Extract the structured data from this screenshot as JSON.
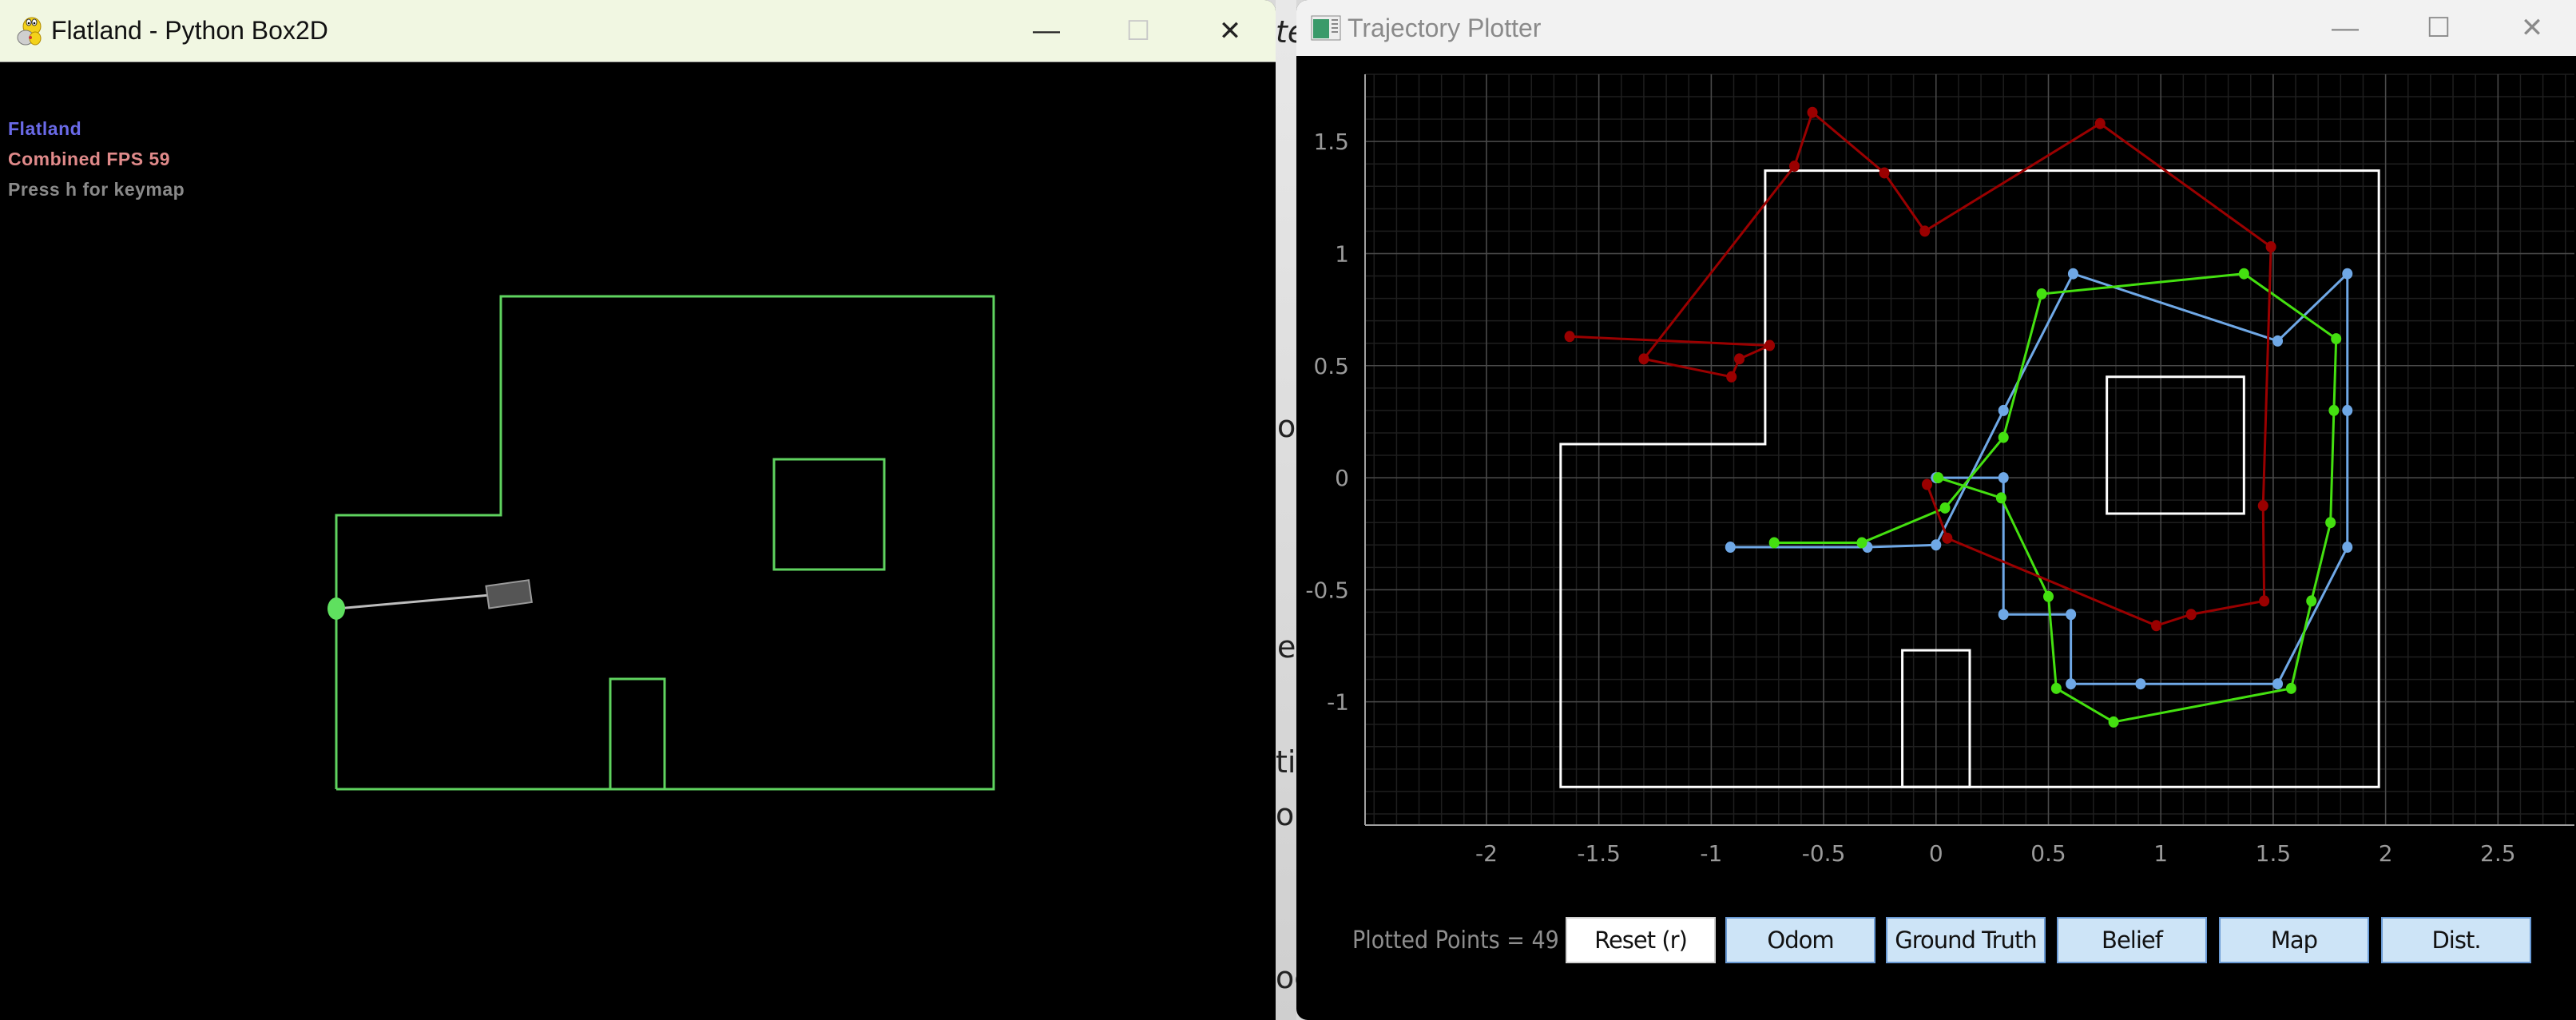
{
  "background_fragments": [
    "te",
    "o",
    "e",
    "tin",
    "orr",
    "oc"
  ],
  "flatland_window": {
    "title": "Flatland - Python Box2D",
    "icon": "pygame-snake-icon",
    "controls": {
      "minimize": "—",
      "maximize": "☐",
      "close": "✕"
    },
    "overlay": {
      "app_name": "Flatland",
      "fps_label": "Combined FPS 59",
      "hint": "Press h for keymap"
    },
    "colors": {
      "walls": "#5fd35f",
      "app_name": "#6a6ae8",
      "fps": "#e08a8a",
      "hint": "#8a8a8a",
      "robot": "#555555",
      "sensor_hit": "#5fe05f"
    }
  },
  "plotter_window": {
    "title": "Trajectory Plotter",
    "icon": "plotter-app-icon",
    "controls": {
      "minimize": "—",
      "maximize": "☐",
      "close": "✕"
    },
    "plotted_points_label": "Plotted Points = 49",
    "buttons": [
      {
        "label": "Reset (r)",
        "style": "reset"
      },
      {
        "label": "Odom",
        "style": "toggle"
      },
      {
        "label": "Ground Truth",
        "style": "toggle"
      },
      {
        "label": "Belief",
        "style": "toggle"
      },
      {
        "label": "Map",
        "style": "toggle"
      },
      {
        "label": "Dist.",
        "style": "toggle"
      }
    ]
  },
  "chart_data": {
    "type": "line",
    "title": "",
    "xlabel": "",
    "ylabel": "",
    "xlim": [
      -2.54,
      2.84
    ],
    "ylim": [
      -1.55,
      1.8
    ],
    "grid": true,
    "x_ticks": [
      -2,
      -1.5,
      -1,
      -0.5,
      0,
      0.5,
      1,
      1.5,
      2,
      2.5
    ],
    "x_tick_labels": [
      "-2",
      "-1.5",
      "-1",
      "-0.5",
      "0",
      "0.5",
      "1",
      "1.5",
      "2",
      "2.5"
    ],
    "y_ticks": [
      1.5,
      1,
      0.5,
      0,
      -0.5,
      -1
    ],
    "y_tick_labels": [
      "1.5",
      "1",
      "0.5",
      "0",
      "-0.5",
      "-1"
    ],
    "series": [
      {
        "name": "Odom",
        "color": "#6fa8e6",
        "points": [
          [
            -0.915,
            -0.31
          ],
          [
            -0.305,
            -0.31
          ],
          [
            0,
            -0.3
          ],
          [
            0.3,
            0.3
          ],
          [
            0.61,
            0.91
          ],
          [
            1.52,
            0.61
          ],
          [
            1.83,
            0.91
          ],
          [
            1.83,
            0.3
          ],
          [
            1.83,
            -0.31
          ],
          [
            1.52,
            -0.92
          ],
          [
            0.91,
            -0.92
          ],
          [
            0.6,
            -0.92
          ],
          [
            0.6,
            -0.61
          ],
          [
            0.3,
            -0.61
          ],
          [
            0.3,
            0
          ],
          [
            0,
            0
          ]
        ]
      },
      {
        "name": "Ground Truth",
        "color": "#44e010",
        "points": [
          [
            -0.72,
            -0.29
          ],
          [
            -0.33,
            -0.29
          ],
          [
            0.04,
            -0.135
          ],
          [
            0.3,
            0.18
          ],
          [
            0.47,
            0.82
          ],
          [
            1.37,
            0.91
          ],
          [
            1.78,
            0.62
          ],
          [
            1.77,
            0.3
          ],
          [
            1.755,
            -0.2
          ],
          [
            1.67,
            -0.55
          ],
          [
            1.58,
            -0.94
          ],
          [
            0.79,
            -1.09
          ],
          [
            0.535,
            -0.94
          ],
          [
            0.5,
            -0.53
          ],
          [
            0.29,
            -0.09
          ],
          [
            0.01,
            0.0
          ]
        ]
      },
      {
        "name": "Belief",
        "color": "#9a0000",
        "points": [
          [
            -0.04,
            -0.03
          ],
          [
            0.05,
            -0.27
          ],
          [
            0.98,
            -0.66
          ],
          [
            1.135,
            -0.61
          ],
          [
            1.46,
            -0.55
          ],
          [
            1.455,
            -0.125
          ],
          [
            1.49,
            1.03
          ],
          [
            0.73,
            1.58
          ],
          [
            -0.05,
            1.1
          ],
          [
            -0.23,
            1.36
          ],
          [
            -0.55,
            1.63
          ],
          [
            -0.63,
            1.39
          ],
          [
            -1.3,
            0.53
          ],
          [
            -0.91,
            0.45
          ],
          [
            -0.875,
            0.53
          ],
          [
            -0.74,
            0.59
          ],
          [
            -1.63,
            0.63
          ]
        ]
      }
    ],
    "map": {
      "color": "#ffffff",
      "polygons": [
        [
          [
            -1.67,
            -1.38
          ],
          [
            -1.67,
            0.15
          ],
          [
            -0.76,
            0.15
          ],
          [
            -0.76,
            1.37
          ],
          [
            1.97,
            1.37
          ],
          [
            1.97,
            -1.38
          ]
        ],
        [
          [
            0.76,
            -0.16
          ],
          [
            0.76,
            0.45
          ],
          [
            1.37,
            0.45
          ],
          [
            1.37,
            -0.16
          ]
        ],
        [
          [
            -0.15,
            -1.38
          ],
          [
            -0.15,
            -0.77
          ],
          [
            0.15,
            -0.77
          ],
          [
            0.15,
            -1.38
          ]
        ]
      ]
    }
  }
}
